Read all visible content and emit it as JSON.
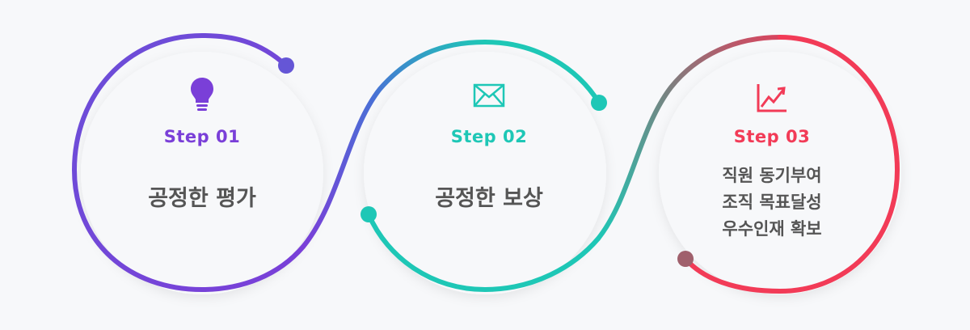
{
  "colors": {
    "purple": "#7a3fd8",
    "blue": "#4a6fd6",
    "teal": "#1ec7b6",
    "red": "#f23b57",
    "text": "#555555"
  },
  "steps": [
    {
      "label": "Step 01",
      "icon": "lightbulb-icon",
      "lines": [
        "공정한 평가"
      ]
    },
    {
      "label": "Step 02",
      "icon": "envelope-icon",
      "lines": [
        "공정한 보상"
      ]
    },
    {
      "label": "Step 03",
      "icon": "growth-chart-icon",
      "lines": [
        "직원 동기부여",
        "조직 목표달성",
        "우수인재 확보"
      ]
    }
  ]
}
